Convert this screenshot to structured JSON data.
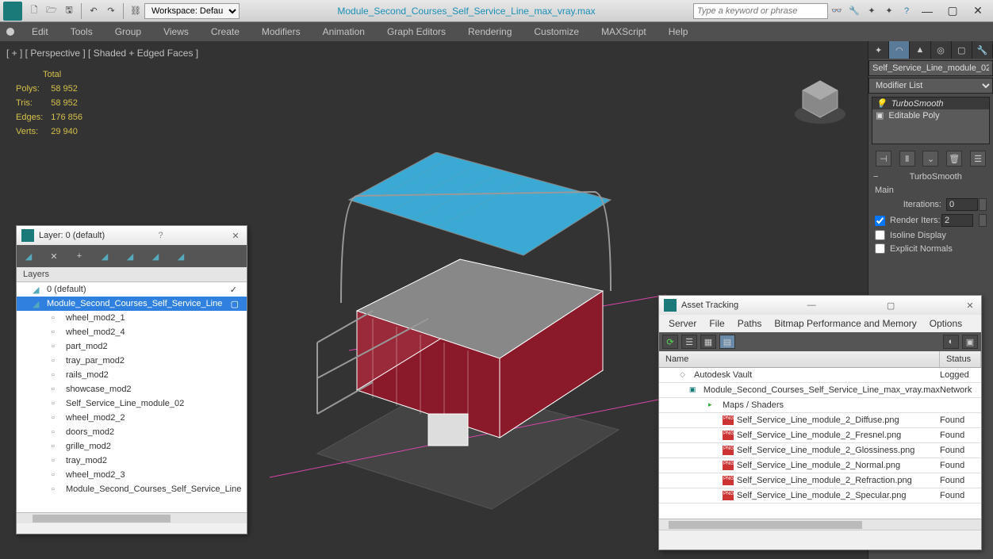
{
  "workspace": {
    "label": "Workspace: Default"
  },
  "filename": "Module_Second_Courses_Self_Service_Line_max_vray.max",
  "search": {
    "placeholder": "Type a keyword or phrase"
  },
  "menu": [
    "Edit",
    "Tools",
    "Group",
    "Views",
    "Create",
    "Modifiers",
    "Animation",
    "Graph Editors",
    "Rendering",
    "Customize",
    "MAXScript",
    "Help"
  ],
  "viewport": {
    "label": "[ + ] [ Perspective ] [ Shaded + Edged Faces ]",
    "stats_title": "Total",
    "stats": [
      {
        "k": "Polys:",
        "v": "58 952"
      },
      {
        "k": "Tris:",
        "v": "58 952"
      },
      {
        "k": "Edges:",
        "v": "176 856"
      },
      {
        "k": "Verts:",
        "v": "29 940"
      }
    ]
  },
  "side": {
    "object_name": "Self_Service_Line_module_02",
    "modifier_list": "Modifier List",
    "stack": [
      {
        "name": "TurboSmooth",
        "sel": true
      },
      {
        "name": "Editable Poly",
        "sel": false
      }
    ],
    "rollup": "TurboSmooth",
    "group": "Main",
    "iterations": {
      "label": "Iterations:",
      "value": "0"
    },
    "render_iters": {
      "label": "Render Iters:",
      "value": "2"
    },
    "isoline": "Isoline Display",
    "explicit": "Explicit Normals"
  },
  "layer_dlg": {
    "title": "Layer: 0 (default)",
    "header": "Layers",
    "items": [
      {
        "indent": 0,
        "ic": "layer",
        "label": "0 (default)",
        "chk": true
      },
      {
        "indent": 0,
        "ic": "layer",
        "label": "Module_Second_Courses_Self_Service_Line",
        "sel": true,
        "box": true
      },
      {
        "indent": 1,
        "ic": "obj",
        "label": "wheel_mod2_1"
      },
      {
        "indent": 1,
        "ic": "obj",
        "label": "wheel_mod2_4"
      },
      {
        "indent": 1,
        "ic": "obj",
        "label": "part_mod2"
      },
      {
        "indent": 1,
        "ic": "obj",
        "label": "tray_par_mod2"
      },
      {
        "indent": 1,
        "ic": "obj",
        "label": "rails_mod2"
      },
      {
        "indent": 1,
        "ic": "obj",
        "label": "showcase_mod2"
      },
      {
        "indent": 1,
        "ic": "obj",
        "label": "Self_Service_Line_module_02"
      },
      {
        "indent": 1,
        "ic": "obj",
        "label": "wheel_mod2_2"
      },
      {
        "indent": 1,
        "ic": "obj",
        "label": "doors_mod2"
      },
      {
        "indent": 1,
        "ic": "obj",
        "label": "grille_mod2"
      },
      {
        "indent": 1,
        "ic": "obj",
        "label": "tray_mod2"
      },
      {
        "indent": 1,
        "ic": "obj",
        "label": "wheel_mod2_3"
      },
      {
        "indent": 1,
        "ic": "obj",
        "label": "Module_Second_Courses_Self_Service_Line"
      }
    ]
  },
  "asset_dlg": {
    "title": "Asset Tracking",
    "menu": [
      "Server",
      "File",
      "Paths",
      "Bitmap Performance and Memory",
      "Options"
    ],
    "headers": {
      "name": "Name",
      "status": "Status"
    },
    "rows": [
      {
        "indent": 0,
        "ic": "vault",
        "name": "Autodesk Vault",
        "status": "Logged"
      },
      {
        "indent": 1,
        "ic": "max",
        "name": "Module_Second_Courses_Self_Service_Line_max_vray.max",
        "status": "Network"
      },
      {
        "indent": 2,
        "ic": "folder",
        "name": "Maps / Shaders",
        "status": ""
      },
      {
        "indent": 3,
        "ic": "png",
        "name": "Self_Service_Line_module_2_Diffuse.png",
        "status": "Found"
      },
      {
        "indent": 3,
        "ic": "png",
        "name": "Self_Service_Line_module_2_Fresnel.png",
        "status": "Found"
      },
      {
        "indent": 3,
        "ic": "png",
        "name": "Self_Service_Line_module_2_Glossiness.png",
        "status": "Found"
      },
      {
        "indent": 3,
        "ic": "png",
        "name": "Self_Service_Line_module_2_Normal.png",
        "status": "Found"
      },
      {
        "indent": 3,
        "ic": "png",
        "name": "Self_Service_Line_module_2_Refraction.png",
        "status": "Found"
      },
      {
        "indent": 3,
        "ic": "png",
        "name": "Self_Service_Line_module_2_Specular.png",
        "status": "Found"
      }
    ]
  }
}
